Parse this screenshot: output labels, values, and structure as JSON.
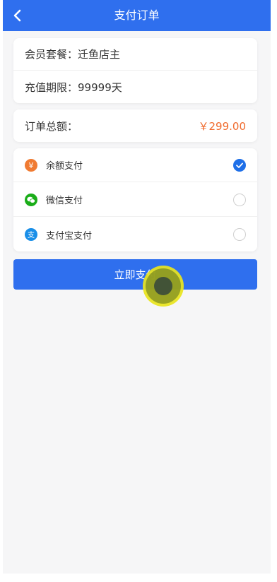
{
  "header": {
    "title": "支付订单",
    "back_icon": "chevron-left-icon"
  },
  "order_info": {
    "package_label": "会员套餐：",
    "package_value": "迁鱼店主",
    "period_label": "充值期限：",
    "period_value": "99999天"
  },
  "total": {
    "label": "订单总额：",
    "amount": "￥299.00"
  },
  "payment_methods": [
    {
      "label": "余额支付",
      "icon": "yen-balance-icon",
      "color": "#f07b32",
      "selected": true
    },
    {
      "label": "微信支付",
      "icon": "wechat-icon",
      "color": "#1aad19",
      "selected": false
    },
    {
      "label": "支付宝支付",
      "icon": "alipay-icon",
      "color": "#1a8fe8",
      "selected": false
    }
  ],
  "pay_button": {
    "label": "立即支付"
  },
  "colors": {
    "primary": "#2f6fee",
    "amount": "#f06a2c",
    "selected_radio": "#1e6fe8"
  }
}
